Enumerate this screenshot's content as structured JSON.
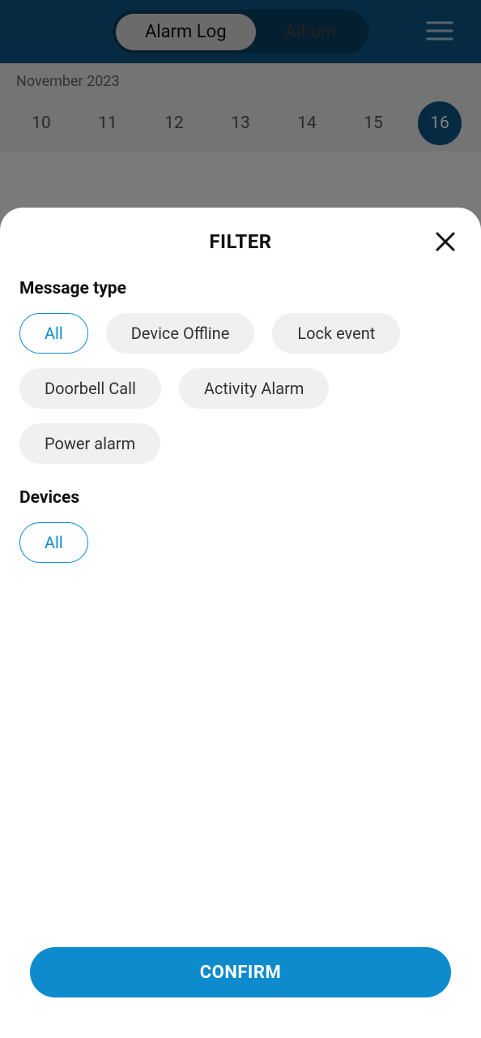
{
  "header": {
    "tab_active": "Alarm Log",
    "tab_inactive": "Album"
  },
  "date_bar": {
    "month_label": "November 2023",
    "dates": [
      "10",
      "11",
      "12",
      "13",
      "14",
      "15",
      "16"
    ],
    "selected_index": 6
  },
  "filter": {
    "title": "FILTER",
    "message_type_label": "Message type",
    "message_types": [
      {
        "label": "All",
        "selected": true
      },
      {
        "label": "Device Offline",
        "selected": false
      },
      {
        "label": "Lock event",
        "selected": false
      },
      {
        "label": "Doorbell Call",
        "selected": false
      },
      {
        "label": "Activity Alarm",
        "selected": false
      },
      {
        "label": "Power alarm",
        "selected": false
      }
    ],
    "devices_label": "Devices",
    "devices": [
      {
        "label": "All",
        "selected": true
      }
    ],
    "confirm_label": "CONFIRM"
  }
}
